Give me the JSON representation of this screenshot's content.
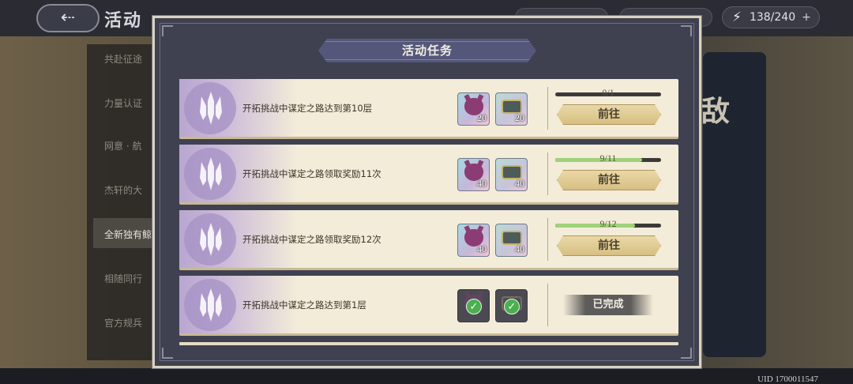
{
  "background": {
    "title": "活动",
    "back_icon": "back-arrow-icon",
    "stamina": {
      "icon": "lightning-icon",
      "value": "138/240",
      "plus": "+"
    },
    "sidebar_items": [
      "共赴征途",
      "力量认证",
      "网意 · 航",
      "杰轩的大",
      "全新独有鲸",
      "相随同行",
      "官方规兵"
    ],
    "big_char": "敌",
    "uid": "UID 1700011547"
  },
  "modal": {
    "title": "活动任务",
    "tasks": [
      {
        "description": "开拓挑战中谋定之路达到第10层",
        "rewards": [
          {
            "icon": "demon-mask-icon",
            "qty": "20"
          },
          {
            "icon": "treasure-chest-icon",
            "qty": "20"
          }
        ],
        "progress_text": "0/1",
        "progress": 0.0,
        "action_label": "前往",
        "completed": false
      },
      {
        "description": "开拓挑战中谋定之路领取奖励11次",
        "rewards": [
          {
            "icon": "demon-mask-icon",
            "qty": "40"
          },
          {
            "icon": "treasure-chest-icon",
            "qty": "40"
          }
        ],
        "progress_text": "9/11",
        "progress": 0.818,
        "action_label": "前往",
        "completed": false
      },
      {
        "description": "开拓挑战中谋定之路领取奖励12次",
        "rewards": [
          {
            "icon": "demon-mask-icon",
            "qty": "40"
          },
          {
            "icon": "treasure-chest-icon",
            "qty": "40"
          }
        ],
        "progress_text": "9/12",
        "progress": 0.75,
        "action_label": "前往",
        "completed": false
      },
      {
        "description": "开拓挑战中谋定之路达到第1层",
        "rewards": [
          {
            "icon": "demon-mask-icon",
            "qty": ""
          },
          {
            "icon": "treasure-chest-icon",
            "qty": ""
          }
        ],
        "status_label": "已完成",
        "completed": true
      }
    ]
  },
  "colors": {
    "progress_fill": "#9fd27a",
    "modal_bg": "#3f4150",
    "row_bg": "#f3ecd9",
    "check_green": "#4caf50"
  }
}
